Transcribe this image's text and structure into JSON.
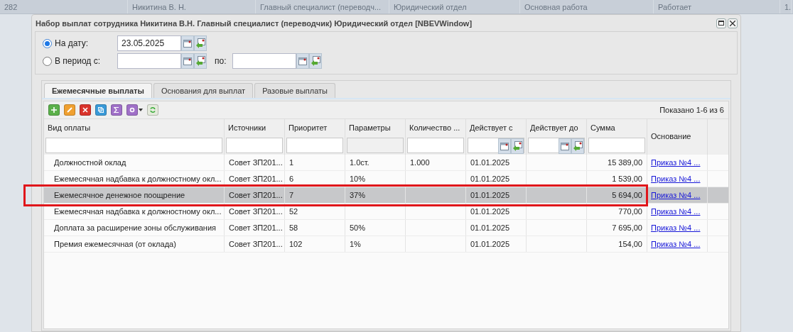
{
  "background_row": [
    "282",
    "Никитина В. Н.",
    "Главный специалист (переводч...",
    "Юридический отдел",
    "Основная работа",
    "Работает",
    "1."
  ],
  "window": {
    "title": "Набор выплат сотрудника Никитина В.Н. Главный специалист (переводчик) Юридический отдел [NBEVWindow]"
  },
  "period": {
    "on_date": {
      "label": "На дату:",
      "selected": true,
      "value": "23.05.2025"
    },
    "range": {
      "label": "В период с:",
      "selected": false,
      "to_label": "по:"
    }
  },
  "tabs": [
    {
      "label": "Ежемесячные выплаты",
      "selected": true
    },
    {
      "label": "Основания для выплат",
      "selected": false
    },
    {
      "label": "Разовые выплаты",
      "selected": false
    }
  ],
  "paging": "Показано 1-6 из 6",
  "table": {
    "columns": [
      {
        "label": "Вид оплаты",
        "kind": "text"
      },
      {
        "label": "Источники",
        "kind": "text"
      },
      {
        "label": "Приоритет",
        "kind": "text"
      },
      {
        "label": "Параметры",
        "kind": "disabled"
      },
      {
        "label": "Количество ...",
        "kind": "text"
      },
      {
        "label": "Действует с",
        "kind": "date"
      },
      {
        "label": "Действует до",
        "kind": "date"
      },
      {
        "label": "Сумма",
        "kind": "text"
      },
      {
        "label": "Основание",
        "kind": "none"
      }
    ],
    "rows": [
      {
        "selected": false,
        "outlined": false,
        "cells": [
          "Должностной оклад",
          "Совет ЗП201...",
          "1",
          "1.0ст.",
          "1.000",
          "01.01.2025",
          "",
          "15 389,00",
          "Приказ №4 ..."
        ]
      },
      {
        "selected": false,
        "outlined": false,
        "cells": [
          "Ежемесячная надбавка к должностному окл...",
          "Совет ЗП201...",
          "6",
          "10%",
          "",
          "01.01.2025",
          "",
          "1 539,00",
          "Приказ №4 ..."
        ]
      },
      {
        "selected": true,
        "outlined": true,
        "cells": [
          "Ежемесячное денежное поощрение",
          "Совет ЗП201...",
          "7",
          "37%",
          "",
          "01.01.2025",
          "",
          "5 694,00",
          "Приказ №4 ..."
        ]
      },
      {
        "selected": false,
        "outlined": false,
        "cells": [
          "Ежемесячная надбавка к должностному окл...",
          "Совет ЗП201...",
          "52",
          "",
          "",
          "01.01.2025",
          "",
          "770,00",
          "Приказ №4 ..."
        ]
      },
      {
        "selected": false,
        "outlined": false,
        "cells": [
          "Доплата за расширение зоны обслуживания",
          "Совет ЗП201...",
          "58",
          "50%",
          "",
          "01.01.2025",
          "",
          "7 695,00",
          "Приказ №4 ..."
        ]
      },
      {
        "selected": false,
        "outlined": false,
        "cells": [
          "Премия ежемесячная (от оклада)",
          "Совет ЗП201...",
          "102",
          "1%",
          "",
          "01.01.2025",
          "",
          "154,00",
          "Приказ №4 ..."
        ]
      }
    ]
  }
}
